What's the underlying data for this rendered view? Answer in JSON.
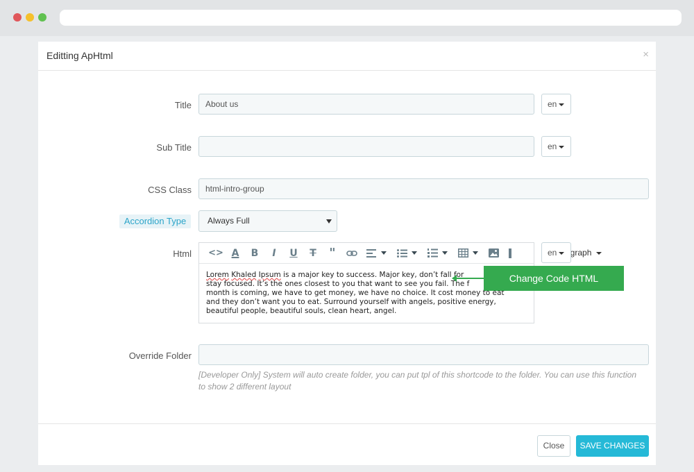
{
  "modal": {
    "title": "Editting ApHtml",
    "close_glyph": "×"
  },
  "form": {
    "title": {
      "label": "Title",
      "value": "About us",
      "lang": "en"
    },
    "subtitle": {
      "label": "Sub Title",
      "value": "",
      "lang": "en"
    },
    "css_class": {
      "label": "CSS Class",
      "value": "html-intro-group"
    },
    "accordion_type": {
      "label": "Accordion Type",
      "selected": "Always Full"
    },
    "html": {
      "label": "Html",
      "lang": "en",
      "format_select": "agraph",
      "toolbar_icons": [
        "code-icon",
        "text-color-icon",
        "bold-icon",
        "italic-icon",
        "underline-icon",
        "strikethrough-icon",
        "quote-icon",
        "link-icon",
        "align-icon",
        "bullet-list-icon",
        "numbered-list-icon",
        "table-icon",
        "image-icon",
        "copy-icon"
      ],
      "content": {
        "part1": "Lorem",
        "part2": "Khaled",
        "part3": "Ipsum",
        "rest_line1": " is a major key to success. Major key, don’t fall for",
        "line2": "stay focused. It’s the ones closest to you that want to see you fail. The f",
        "line3": "month is coming, we have to get money, we have no choice. It cost money to eat",
        "line4": "and they don’t want you to eat. Surround yourself with angels, positive energy,",
        "line5": "beautiful people, beautiful souls, clean heart, angel."
      }
    },
    "override_folder": {
      "label": "Override Folder",
      "value": "",
      "help": "[Developer Only] System will auto create folder, you can put tpl of this shortcode to the folder. You can use this function to show 2 different layout"
    }
  },
  "tooltip": {
    "text": "Change Code HTML"
  },
  "footer": {
    "close_label": "Close",
    "save_label": "SAVE CHANGES"
  },
  "colors": {
    "accent": "#25b9d7",
    "tooltip": "#35aa4f",
    "accordion_label": "#2ba4c9"
  }
}
